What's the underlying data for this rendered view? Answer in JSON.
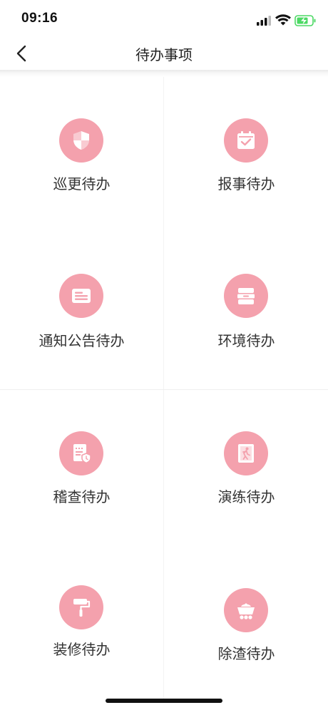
{
  "status_bar": {
    "time": "09:16"
  },
  "header": {
    "title": "待办事项"
  },
  "colors": {
    "icon_circle": "#f4a1ad",
    "battery_green": "#4cd964"
  },
  "items": [
    {
      "label": "巡更待办",
      "icon": "shield-icon"
    },
    {
      "label": "报事待办",
      "icon": "calendar-check-icon"
    },
    {
      "label": "通知公告待办",
      "icon": "notice-icon"
    },
    {
      "label": "环境待办",
      "icon": "cabinet-icon"
    },
    {
      "label": "稽查待办",
      "icon": "audit-doc-icon"
    },
    {
      "label": "演练待办",
      "icon": "exit-runner-icon"
    },
    {
      "label": "装修待办",
      "icon": "paint-roller-icon"
    },
    {
      "label": "除渣待办",
      "icon": "cart-icon"
    }
  ]
}
